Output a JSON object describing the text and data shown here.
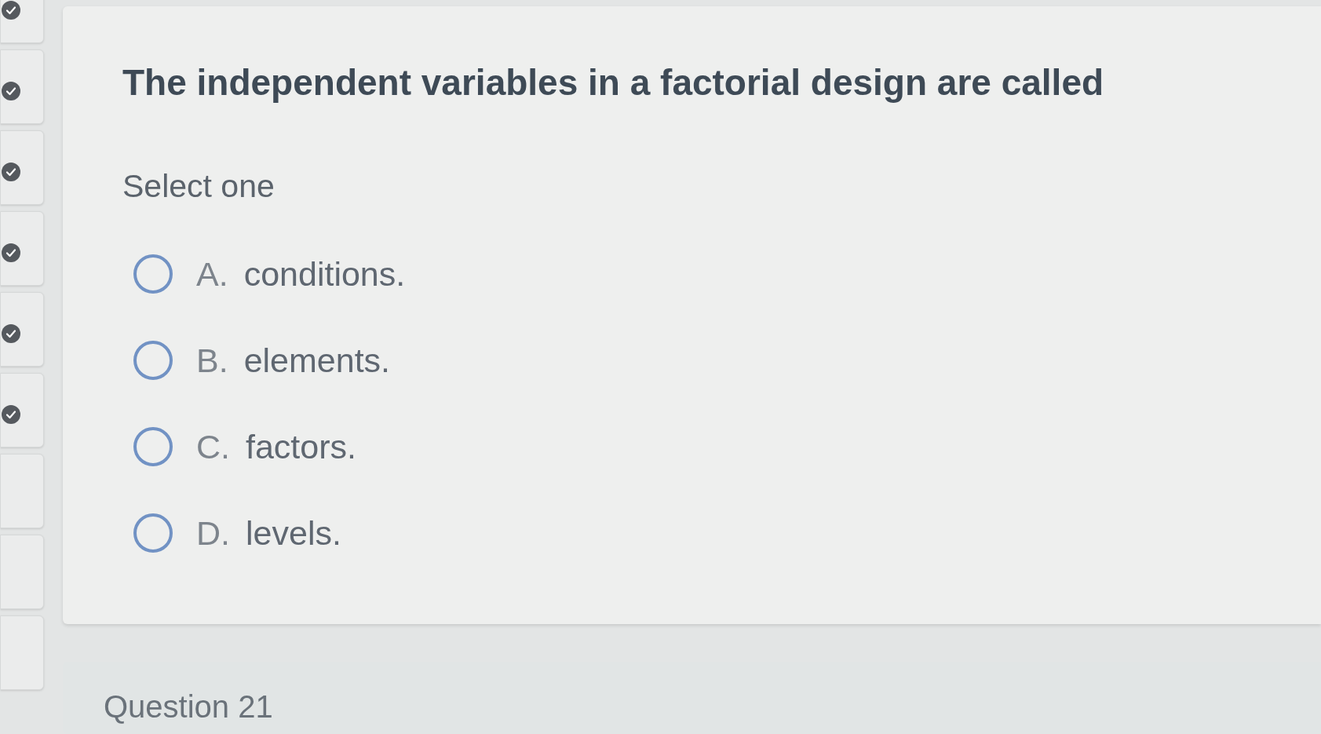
{
  "sidebar": {
    "tiles": [
      {
        "answered": true
      },
      {
        "answered": true
      },
      {
        "answered": true
      },
      {
        "answered": true
      },
      {
        "answered": true
      },
      {
        "answered": true
      },
      {
        "answered": false
      },
      {
        "answered": false
      },
      {
        "answered": false
      }
    ]
  },
  "question": {
    "text": "The independent variables in a factorial design are called",
    "prompt": "Select one",
    "options": [
      {
        "letter": "A.",
        "text": "conditions.",
        "selected": false
      },
      {
        "letter": "B.",
        "text": "elements.",
        "selected": false
      },
      {
        "letter": "C.",
        "text": "factors.",
        "selected": false
      },
      {
        "letter": "D.",
        "text": "levels.",
        "selected": false
      }
    ]
  },
  "next_question": {
    "title": "Question 21"
  }
}
